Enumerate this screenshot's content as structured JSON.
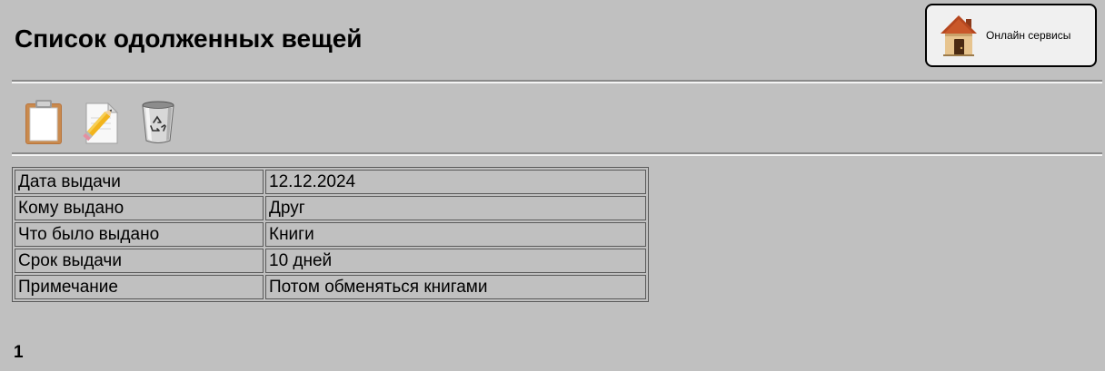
{
  "header": {
    "title": "Список одолженных вещей",
    "online_services_label": "Онлайн сервисы"
  },
  "toolbar": {
    "tools": [
      {
        "icon": "clipboard-icon"
      },
      {
        "icon": "edit-document-icon"
      },
      {
        "icon": "recycle-bin-icon"
      }
    ]
  },
  "details": {
    "rows": [
      {
        "label": "Дата выдачи",
        "value": "12.12.2024"
      },
      {
        "label": "Кому выдано",
        "value": "Друг"
      },
      {
        "label": "Что было выдано",
        "value": "Книги"
      },
      {
        "label": "Срок выдачи",
        "value": "10 дней"
      },
      {
        "label": "Примечание",
        "value": "Потом обменяться книгами"
      }
    ]
  },
  "pagination": {
    "current_page": "1"
  },
  "colors": {
    "background": "#c0c0c0",
    "button_background": "#f0f0f0",
    "table_border": "#5a5a5a"
  }
}
